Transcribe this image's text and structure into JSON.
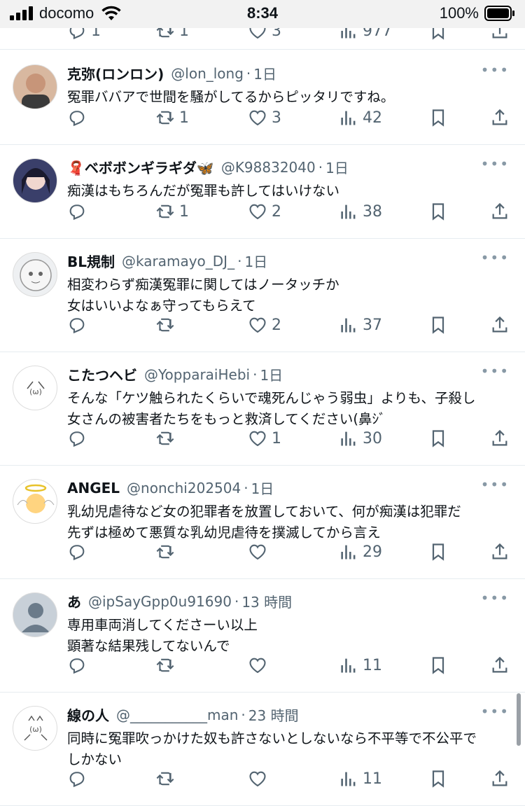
{
  "status_bar": {
    "carrier": "docomo",
    "time": "8:34",
    "battery": "100%"
  },
  "partial_top": {
    "reply": "1",
    "retweet": "1",
    "like": "3",
    "views": "977"
  },
  "tweets": [
    {
      "name": "克弥(ロンロン)",
      "handle": "@lon_long",
      "time": "1日",
      "lines": [
        "冤罪ババアで世間を騒がしてるからピッタリですね。"
      ],
      "reply": "",
      "retweet": "1",
      "like": "3",
      "views": "42"
    },
    {
      "name": "🧣ベボボンギラギダ🦋",
      "handle": "@K98832040",
      "time": "1日",
      "lines": [
        "痴漢はもちろんだが冤罪も許してはいけない"
      ],
      "reply": "",
      "retweet": "1",
      "like": "2",
      "views": "38"
    },
    {
      "name": "BL規制",
      "handle": "@karamayo_DJ_",
      "time": "1日",
      "lines": [
        "相変わらず痴漢冤罪に関してはノータッチか",
        "女はいいよなぁ守ってもらえて"
      ],
      "reply": "",
      "retweet": "",
      "like": "2",
      "views": "37"
    },
    {
      "name": "こたつヘビ",
      "handle": "@YopparaiHebi",
      "time": "1日",
      "lines": [
        "そんな「ケツ触られたくらいで魂死んじゃう弱虫」よりも、子殺し",
        "女さんの被害者たちをもっと救済してください(鼻ｼﾞ"
      ],
      "reply": "",
      "retweet": "",
      "like": "1",
      "views": "30"
    },
    {
      "name": "ANGEL",
      "handle": "@nonchi202504",
      "time": "1日",
      "lines": [
        "乳幼児虐待など女の犯罪者を放置しておいて、何が痴漢は犯罪だ",
        "先ずは極めて悪質な乳幼児虐待を撲滅してから言え"
      ],
      "reply": "",
      "retweet": "",
      "like": "",
      "views": "29"
    },
    {
      "name": "あ",
      "handle": "@ipSayGpp0u91690",
      "time": "13 時間",
      "lines": [
        "専用車両消してくださーい以上",
        "顕著な結果残してないんで"
      ],
      "reply": "",
      "retweet": "",
      "like": "",
      "views": "11"
    },
    {
      "name": "線の人",
      "handle": "@___________man",
      "time": "23 時間",
      "lines": [
        "同時に冤罪吹っかけた奴も許さないとしないなら不平等で不公平で",
        "しかない"
      ],
      "reply": "",
      "retweet": "",
      "like": "",
      "views": "11"
    }
  ],
  "ui": {
    "more": "•••",
    "sep": "·"
  },
  "colors": {
    "text": "#0f1419",
    "secondary": "#536471",
    "divider": "#e6ecf0",
    "status_bg": "#f2f2f2"
  }
}
